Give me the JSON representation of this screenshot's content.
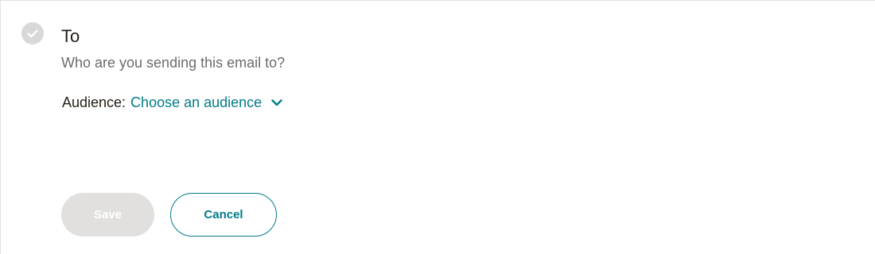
{
  "section": {
    "title": "To",
    "subtitle": "Who are you sending this email to?",
    "status_icon": "check-circle-icon"
  },
  "audience": {
    "label": "Audience:",
    "value": "Choose an audience",
    "dropdown_icon": "chevron-down-icon"
  },
  "actions": {
    "save_label": "Save",
    "save_disabled": true,
    "cancel_label": "Cancel"
  },
  "colors": {
    "accent": "#007c89",
    "text": "#241c15",
    "muted_text": "#6b6b6b",
    "disabled_bg": "#e1e0de",
    "check_bg": "#d9d8d6"
  }
}
